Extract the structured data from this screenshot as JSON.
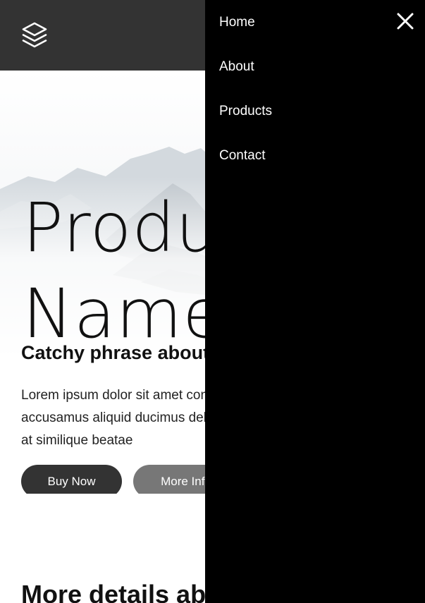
{
  "header": {
    "logo_icon": "layers-icon",
    "background": "#333333"
  },
  "hero": {
    "title_line1": "Product",
    "title_line2": "Name",
    "tagline": "Catchy phrase about the product",
    "body": "Lorem ipsum dolor sit amet consectetur adipisicing elit. Dolore accusamus aliquid ducimus debitis quam laboriosam sequi quae at similique beatae",
    "buttons": {
      "buy_label": "Buy Now",
      "more_label": "More Info"
    }
  },
  "details": {
    "heading": "More details about the product"
  },
  "nav": {
    "items": [
      {
        "label": "Home"
      },
      {
        "label": "About"
      },
      {
        "label": "Products"
      },
      {
        "label": "Contact"
      }
    ],
    "close_icon": "close-icon"
  },
  "colors": {
    "header_bg": "#333333",
    "drawer_bg": "#000000",
    "primary_button": "#333333",
    "secondary_button": "#777777"
  }
}
